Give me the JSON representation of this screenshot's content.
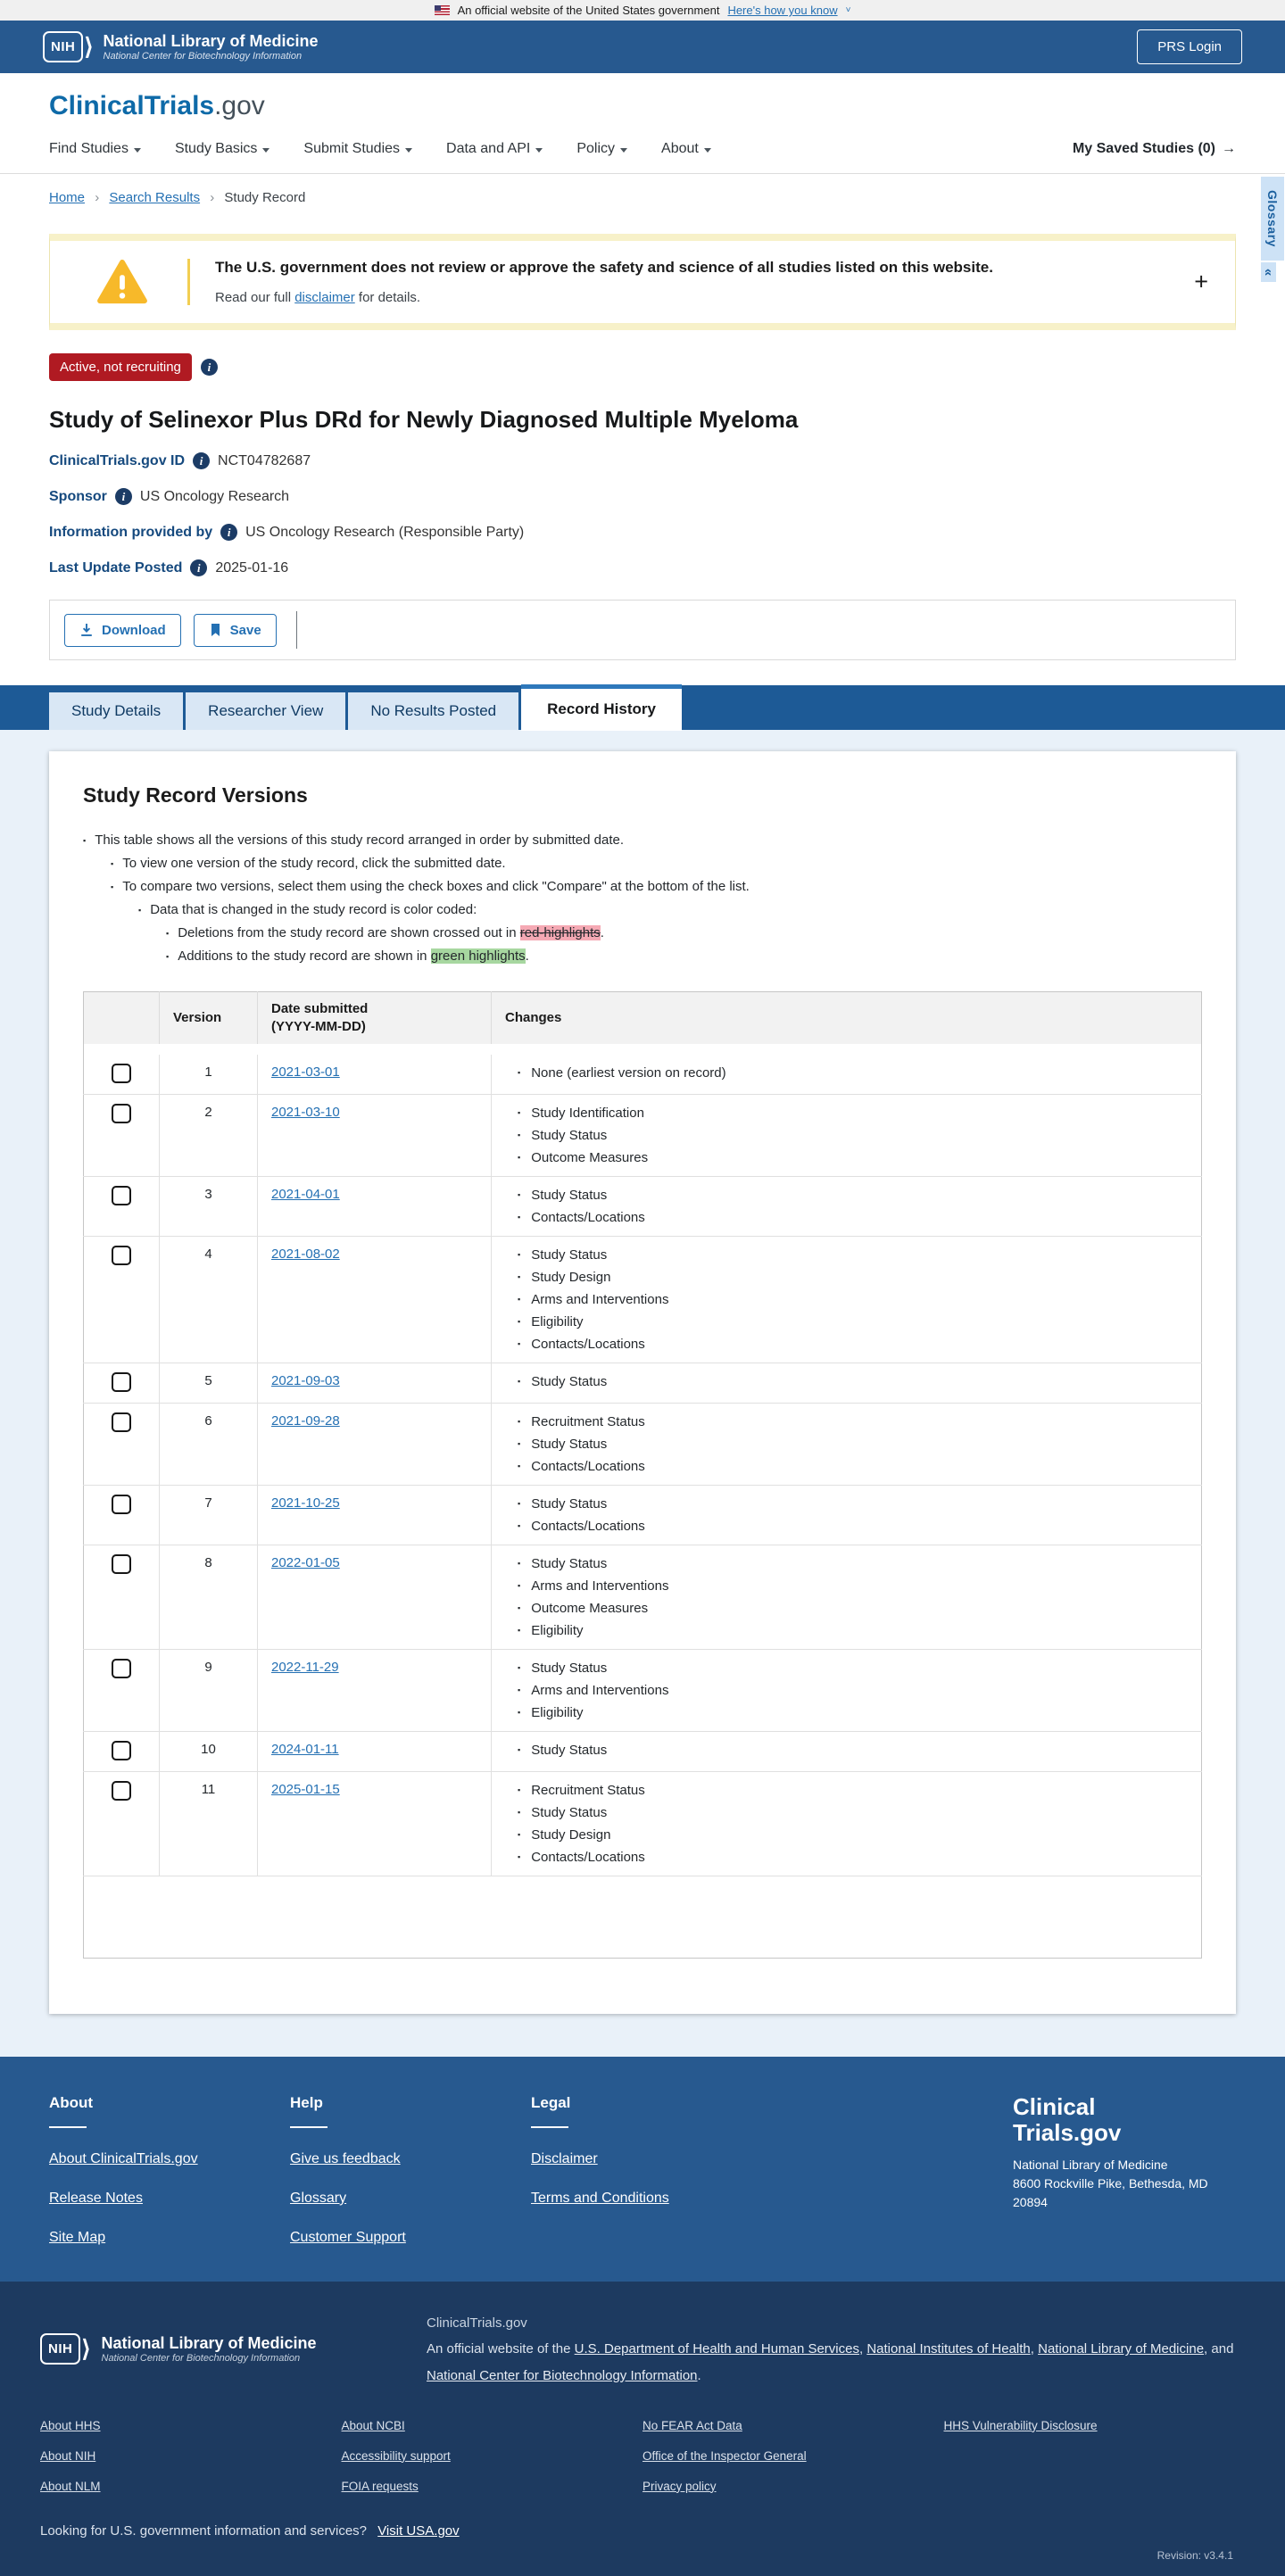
{
  "colors": {
    "header_blue": "#27598f",
    "tab_band_blue": "#1d5a96",
    "page_bg_blue": "#e9f1f9",
    "footer_navy": "#1d3a60",
    "badge_red": "#b01a22",
    "link_blue": "#2470b3",
    "warning_amber": "#f7b92a",
    "highlight_red": "#f5a9b4",
    "highlight_green": "#a7d7a0"
  },
  "banner": {
    "text": "An official website of the United States government",
    "link_label": "Here's how you know"
  },
  "nih_header": {
    "logo_acronym": "NIH",
    "logo_title": "National Library of Medicine",
    "logo_subtitle": "National Center for Biotechnology Information",
    "prs_login_label": "PRS Login"
  },
  "site_header": {
    "logo_primary": "ClinicalTrials",
    "logo_suffix": ".gov",
    "nav_items": [
      "Find Studies",
      "Study Basics",
      "Submit Studies",
      "Data and API",
      "Policy",
      "About"
    ],
    "saved_studies_label": "My Saved Studies (0)",
    "saved_studies_arrow": "→"
  },
  "breadcrumb": {
    "links": [
      "Home",
      "Search Results"
    ],
    "current": "Study Record"
  },
  "glossary": {
    "tab_label": "Glossary",
    "collapse_icon": "«"
  },
  "warning": {
    "heading": "The U.S. government does not review or approve the safety and science of all studies listed on this website.",
    "body_prefix": "Read our full ",
    "body_link": "disclaimer",
    "body_suffix": " for details.",
    "expand_icon": "+"
  },
  "study": {
    "status_badge": "Active, not recruiting",
    "title": "Study of Selinexor Plus DRd for Newly Diagnosed Multiple Myeloma",
    "fields": [
      {
        "label": "ClinicalTrials.gov ID",
        "value": "NCT04782687"
      },
      {
        "label": "Sponsor",
        "value": "US Oncology Research"
      },
      {
        "label": "Information provided by",
        "value": "US Oncology Research (Responsible Party)"
      },
      {
        "label": "Last Update Posted",
        "value": "2025-01-16"
      }
    ]
  },
  "toolbar": {
    "download_label": "Download",
    "save_label": "Save"
  },
  "tabs": [
    {
      "label": "Study Details",
      "active": false
    },
    {
      "label": "Researcher View",
      "active": false
    },
    {
      "label": "No Results Posted",
      "active": false
    },
    {
      "label": "Record History",
      "active": true
    }
  ],
  "record_history": {
    "heading": "Study Record Versions",
    "notes": [
      {
        "depth": 1,
        "text": "This table shows all the versions of this study record arranged in order by submitted date."
      },
      {
        "depth": 2,
        "text": "To view one version of the study record, click the submitted date."
      },
      {
        "depth": 2,
        "text": "To compare two versions, select them using the check boxes and click \"Compare\" at the bottom of the list."
      },
      {
        "depth": 3,
        "text": "Data that is changed in the study record is color coded:"
      },
      {
        "depth": 4,
        "text": "Deletions from the study record are shown crossed out in ",
        "highlight": "red-highlights",
        "highlight_style": "red",
        "suffix": "."
      },
      {
        "depth": 4,
        "text": "Additions to the study record are shown in ",
        "highlight": "green highlights",
        "highlight_style": "green",
        "suffix": "."
      }
    ],
    "table": {
      "header_version": "Version",
      "header_date_line1": "Date submitted",
      "header_date_line2": "(YYYY-MM-DD)",
      "header_changes": "Changes",
      "rows": [
        {
          "version": "1",
          "date": "2021-03-01",
          "changes": [
            "None (earliest version on record)"
          ]
        },
        {
          "version": "2",
          "date": "2021-03-10",
          "changes": [
            "Study Identification",
            "Study Status",
            "Outcome Measures"
          ]
        },
        {
          "version": "3",
          "date": "2021-04-01",
          "changes": [
            "Study Status",
            "Contacts/Locations"
          ]
        },
        {
          "version": "4",
          "date": "2021-08-02",
          "changes": [
            "Study Status",
            "Study Design",
            "Arms and Interventions",
            "Eligibility",
            "Contacts/Locations"
          ]
        },
        {
          "version": "5",
          "date": "2021-09-03",
          "changes": [
            "Study Status"
          ]
        },
        {
          "version": "6",
          "date": "2021-09-28",
          "changes": [
            "Recruitment Status",
            "Study Status",
            "Contacts/Locations"
          ]
        },
        {
          "version": "7",
          "date": "2021-10-25",
          "changes": [
            "Study Status",
            "Contacts/Locations"
          ]
        },
        {
          "version": "8",
          "date": "2022-01-05",
          "changes": [
            "Study Status",
            "Arms and Interventions",
            "Outcome Measures",
            "Eligibility"
          ]
        },
        {
          "version": "9",
          "date": "2022-11-29",
          "changes": [
            "Study Status",
            "Arms and Interventions",
            "Eligibility"
          ]
        },
        {
          "version": "10",
          "date": "2024-01-11",
          "changes": [
            "Study Status"
          ]
        },
        {
          "version": "11",
          "date": "2025-01-15",
          "changes": [
            "Recruitment Status",
            "Study Status",
            "Study Design",
            "Contacts/Locations"
          ]
        }
      ]
    }
  },
  "footer": {
    "columns": [
      {
        "heading": "About",
        "links": [
          "About ClinicalTrials.gov",
          "Release Notes",
          "Site Map"
        ]
      },
      {
        "heading": "Help",
        "links": [
          "Give us feedback",
          "Glossary",
          "Customer Support"
        ]
      },
      {
        "heading": "Legal",
        "links": [
          "Disclaimer",
          "Terms and Conditions"
        ]
      }
    ],
    "logo_line1": "Clinical",
    "logo_line2": "Trials.gov",
    "address_lines": [
      "National Library of Medicine",
      "8600 Rockville Pike, Bethesda, MD",
      "20894"
    ]
  },
  "subfooter": {
    "nlm_acronym": "NIH",
    "nlm_title": "National Library of Medicine",
    "nlm_subtitle": "National Center for Biotechnology Information",
    "site_name": "ClinicalTrials.gov",
    "official_prefix": "An official website of the ",
    "official_links": [
      "U.S. Department of Health and Human Services",
      "National Institutes of Health",
      "National Library of Medicine",
      "National Center for Biotechnology Information"
    ],
    "link_columns": [
      [
        "About HHS",
        "About NIH",
        "About NLM"
      ],
      [
        "About NCBI",
        "Accessibility support",
        "FOIA requests"
      ],
      [
        "No FEAR Act Data",
        "Office of the Inspector General",
        "Privacy policy"
      ],
      [
        "HHS Vulnerability Disclosure"
      ]
    ],
    "usa_text": "Looking for U.S. government information and services?",
    "usa_link": "Visit USA.gov",
    "revision": "Revision: v3.4.1"
  }
}
